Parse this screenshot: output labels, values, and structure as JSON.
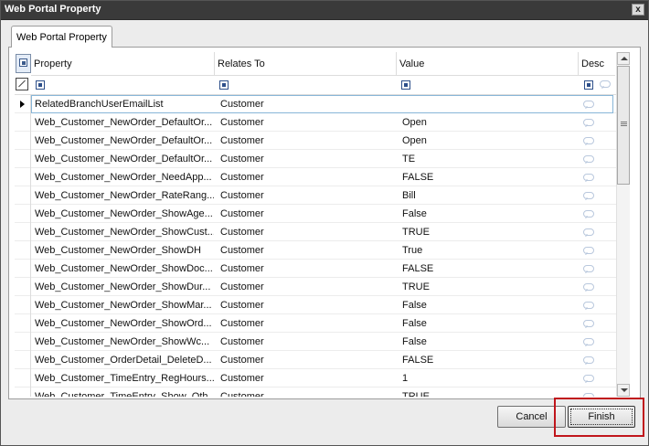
{
  "window": {
    "title": "Web Portal Property",
    "close_glyph": "x"
  },
  "tab": {
    "label": "Web Portal Property"
  },
  "grid": {
    "columns": [
      {
        "label": "Property"
      },
      {
        "label": "Relates To"
      },
      {
        "label": "Value"
      },
      {
        "label": "Desc"
      }
    ],
    "rows": [
      {
        "property": "RelatedBranchUserEmailList",
        "relates_to": "Customer",
        "value": ""
      },
      {
        "property": "Web_Customer_NewOrder_DefaultOr...",
        "relates_to": "Customer",
        "value": "Open"
      },
      {
        "property": "Web_Customer_NewOrder_DefaultOr...",
        "relates_to": "Customer",
        "value": "Open"
      },
      {
        "property": "Web_Customer_NewOrder_DefaultOr...",
        "relates_to": "Customer",
        "value": "TE"
      },
      {
        "property": "Web_Customer_NewOrder_NeedApp...",
        "relates_to": "Customer",
        "value": "FALSE"
      },
      {
        "property": "Web_Customer_NewOrder_RateRang...",
        "relates_to": "Customer",
        "value": "Bill"
      },
      {
        "property": "Web_Customer_NewOrder_ShowAge...",
        "relates_to": "Customer",
        "value": "False"
      },
      {
        "property": "Web_Customer_NewOrder_ShowCust...",
        "relates_to": "Customer",
        "value": "TRUE"
      },
      {
        "property": "Web_Customer_NewOrder_ShowDH",
        "relates_to": "Customer",
        "value": "True"
      },
      {
        "property": "Web_Customer_NewOrder_ShowDoc...",
        "relates_to": "Customer",
        "value": "FALSE"
      },
      {
        "property": "Web_Customer_NewOrder_ShowDur...",
        "relates_to": "Customer",
        "value": "TRUE"
      },
      {
        "property": "Web_Customer_NewOrder_ShowMar...",
        "relates_to": "Customer",
        "value": "False"
      },
      {
        "property": "Web_Customer_NewOrder_ShowOrd...",
        "relates_to": "Customer",
        "value": "False"
      },
      {
        "property": "Web_Customer_NewOrder_ShowWc...",
        "relates_to": "Customer",
        "value": "False"
      },
      {
        "property": "Web_Customer_OrderDetail_DeleteD...",
        "relates_to": "Customer",
        "value": "FALSE"
      },
      {
        "property": "Web_Customer_TimeEntry_RegHours...",
        "relates_to": "Customer",
        "value": "1"
      },
      {
        "property": "Web_Customer_TimeEntry_Show_Oth...",
        "relates_to": "Customer",
        "value": "TRUE"
      }
    ],
    "selected_row": 0
  },
  "buttons": {
    "cancel_label": "Cancel",
    "finish_label": "Finish"
  },
  "colors": {
    "titlebar": "#3a3a3a",
    "highlight": "#c0151b",
    "selected_border": "#88b6d8"
  }
}
